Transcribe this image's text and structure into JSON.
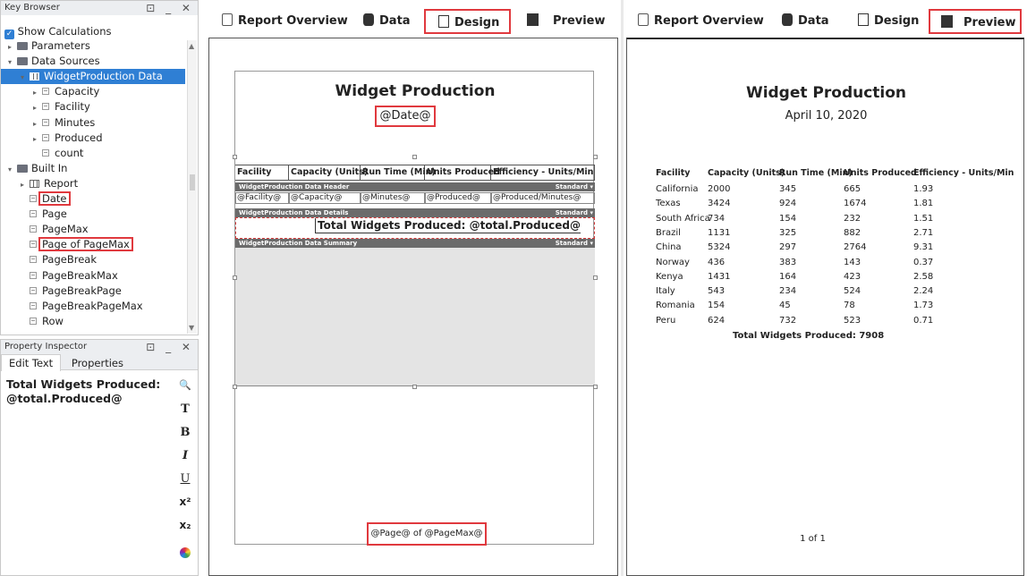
{
  "key_browser": {
    "title": "Key Browser",
    "window_controls": "⊡ _ ✕",
    "show_calculations": "Show Calculations",
    "items": [
      {
        "label": "Parameters",
        "level": 0,
        "kind": "folder",
        "arrow": "▸"
      },
      {
        "label": "Data Sources",
        "level": 0,
        "kind": "folder",
        "arrow": "▾"
      },
      {
        "label": "WidgetProduction Data",
        "level": 1,
        "kind": "table",
        "arrow": "▾"
      },
      {
        "label": "Capacity",
        "level": 2,
        "kind": "key",
        "arrow": "▸"
      },
      {
        "label": "Facility",
        "level": 2,
        "kind": "key",
        "arrow": "▸"
      },
      {
        "label": "Minutes",
        "level": 2,
        "kind": "key",
        "arrow": "▸"
      },
      {
        "label": "Produced",
        "level": 2,
        "kind": "key",
        "arrow": "▸"
      },
      {
        "label": "count",
        "level": 2,
        "kind": "key",
        "arrow": ""
      },
      {
        "label": "Built In",
        "level": 0,
        "kind": "folder",
        "arrow": "▾"
      },
      {
        "label": "Report",
        "level": 1,
        "kind": "grid",
        "arrow": "▸"
      },
      {
        "label": "Date",
        "level": 1,
        "kind": "key",
        "arrow": ""
      },
      {
        "label": "Page",
        "level": 1,
        "kind": "key",
        "arrow": ""
      },
      {
        "label": "PageMax",
        "level": 1,
        "kind": "key",
        "arrow": ""
      },
      {
        "label": "Page of PageMax",
        "level": 1,
        "kind": "key",
        "arrow": ""
      },
      {
        "label": "PageBreak",
        "level": 1,
        "kind": "key",
        "arrow": ""
      },
      {
        "label": "PageBreakMax",
        "level": 1,
        "kind": "key",
        "arrow": ""
      },
      {
        "label": "PageBreakPage",
        "level": 1,
        "kind": "key",
        "arrow": ""
      },
      {
        "label": "PageBreakPageMax",
        "level": 1,
        "kind": "key",
        "arrow": ""
      },
      {
        "label": "Row",
        "level": 1,
        "kind": "key",
        "arrow": ""
      }
    ]
  },
  "property_inspector": {
    "title": "Property Inspector",
    "window_controls": "⊡ _ ✕",
    "tabs": [
      "Edit Text",
      "Properties"
    ],
    "text_line1": "Total Widgets Produced:",
    "text_line2": "@total.Produced@",
    "format_buttons": [
      "🔍",
      "T",
      "B",
      "I",
      "U",
      "x²",
      "x₂"
    ]
  },
  "design_toolbar": {
    "tabs": [
      "Report Overview",
      "Data",
      "Design",
      "Preview"
    ],
    "active": "Design"
  },
  "preview_toolbar": {
    "tabs": [
      "Report Overview",
      "Data",
      "Design",
      "Preview"
    ],
    "active": "Preview"
  },
  "design": {
    "title": "Widget Production",
    "date_key": "@Date@",
    "headers": [
      "Facility",
      "Capacity (Units)",
      "Run Time (Min)",
      "Units Produced",
      "Efficiency - Units/Min"
    ],
    "band_header": "WidgetProduction Data Header",
    "band_details": "WidgetProduction Data Details",
    "band_summary": "WidgetProduction Data Summary",
    "band_mode": "Standard ▾",
    "row_keys": [
      "@Facility@",
      "@Capacity@",
      "@Minutes@",
      "@Produced@",
      "@Produced/Minutes@"
    ],
    "summary_text": "Total Widgets Produced: @total.Produced@",
    "footer": "@Page@ of @PageMax@"
  },
  "preview": {
    "title": "Widget Production",
    "date": "April 10, 2020",
    "headers": [
      "Facility",
      "Capacity (Units)",
      "Run Time (Min)",
      "Units Produced",
      "Efficiency - Units/Min"
    ],
    "rows": [
      [
        "California",
        "2000",
        "345",
        "665",
        "1.93"
      ],
      [
        "Texas",
        "3424",
        "924",
        "1674",
        "1.81"
      ],
      [
        "South Africa",
        "734",
        "154",
        "232",
        "1.51"
      ],
      [
        "Brazil",
        "1131",
        "325",
        "882",
        "2.71"
      ],
      [
        "China",
        "5324",
        "297",
        "2764",
        "9.31"
      ],
      [
        "Norway",
        "436",
        "383",
        "143",
        "0.37"
      ],
      [
        "Kenya",
        "1431",
        "164",
        "423",
        "2.58"
      ],
      [
        "Italy",
        "543",
        "234",
        "524",
        "2.24"
      ],
      [
        "Romania",
        "154",
        "45",
        "78",
        "1.73"
      ],
      [
        "Peru",
        "624",
        "732",
        "523",
        "0.71"
      ]
    ],
    "total": "Total Widgets Produced: 7908",
    "footer": "1 of 1"
  },
  "colors": {
    "highlight": "#e0393e",
    "selection": "#2f7fd4"
  }
}
